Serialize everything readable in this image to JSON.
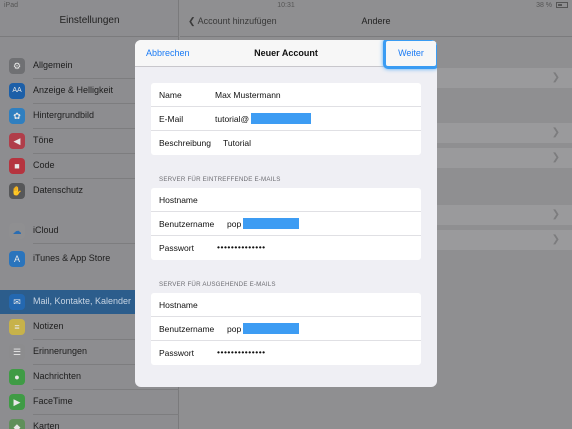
{
  "statusbar": {
    "device": "iPad",
    "time": "10:31",
    "battery": "38 %"
  },
  "sidebar": {
    "title": "Einstellungen",
    "items": [
      {
        "label": "Allgemein",
        "icon": "gear-icon",
        "color": "#6f7073"
      },
      {
        "label": "Anzeige & Helligkeit",
        "icon": "display-icon",
        "color": "#1c5fa8"
      },
      {
        "label": "Hintergrundbild",
        "icon": "flower-icon",
        "color": "#2f7fc0"
      },
      {
        "label": "Töne",
        "icon": "speaker-icon",
        "color": "#b03e4a"
      },
      {
        "label": "Code",
        "icon": "lock-icon",
        "color": "#b5343f"
      },
      {
        "label": "Datenschutz",
        "icon": "hand-icon",
        "color": "#565759"
      },
      {
        "label": "iCloud",
        "icon": "cloud-icon",
        "color": "#8f8f91"
      },
      {
        "label": "iTunes & App Store",
        "icon": "appstore-icon",
        "color": "#2a74bc"
      },
      {
        "label": "Mail, Kontakte, Kalender",
        "icon": "mail-icon",
        "color": "#2468b0"
      },
      {
        "label": "Notizen",
        "icon": "notes-icon",
        "color": "#c7b24a"
      },
      {
        "label": "Erinnerungen",
        "icon": "list-icon",
        "color": "#8c8c8e"
      },
      {
        "label": "Nachrichten",
        "icon": "message-icon",
        "color": "#3f9b45"
      },
      {
        "label": "FaceTime",
        "icon": "video-icon",
        "color": "#3f9b45"
      },
      {
        "label": "Karten",
        "icon": "map-icon",
        "color": "#5f8f5a"
      }
    ]
  },
  "rightpane": {
    "back_label": "Account hinzufügen",
    "title": "Andere"
  },
  "modal": {
    "cancel_label": "Abbrechen",
    "title": "Neuer Account",
    "next_label": "Weiter",
    "account": {
      "name_label": "Name",
      "name_value": "Max Mustermann",
      "email_label": "E-Mail",
      "email_value": "tutorial@",
      "desc_label": "Beschreibung",
      "desc_value": "Tutorial"
    },
    "incoming": {
      "header": "SERVER FÜR EINTREFFENDE E-MAILS",
      "host_label": "Hostname",
      "user_label": "Benutzername",
      "user_value": "pop",
      "pass_label": "Passwort",
      "pass_value": "••••••••••••••"
    },
    "outgoing": {
      "header": "SERVER FÜR AUSGEHENDE E-MAILS",
      "host_label": "Hostname",
      "user_label": "Benutzername",
      "user_value": "pop",
      "pass_label": "Passwort",
      "pass_value": "••••••••••••••"
    }
  },
  "colors": {
    "accent": "#1b7bf4",
    "highlight": "#3a9cf3",
    "redaction": "#3d9cf3"
  }
}
